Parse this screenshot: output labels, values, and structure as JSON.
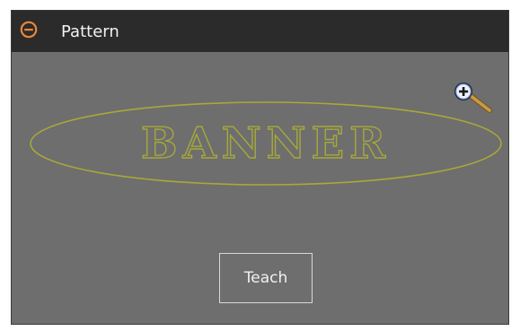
{
  "header": {
    "title": "Pattern",
    "collapse_icon": "minus-circle-icon",
    "accent_color": "#e8873a"
  },
  "canvas": {
    "zoom_icon": "zoom-in-icon",
    "pattern_text": "BANNER",
    "pattern_color": "#9a9a3a"
  },
  "actions": {
    "teach_label": "Teach"
  }
}
